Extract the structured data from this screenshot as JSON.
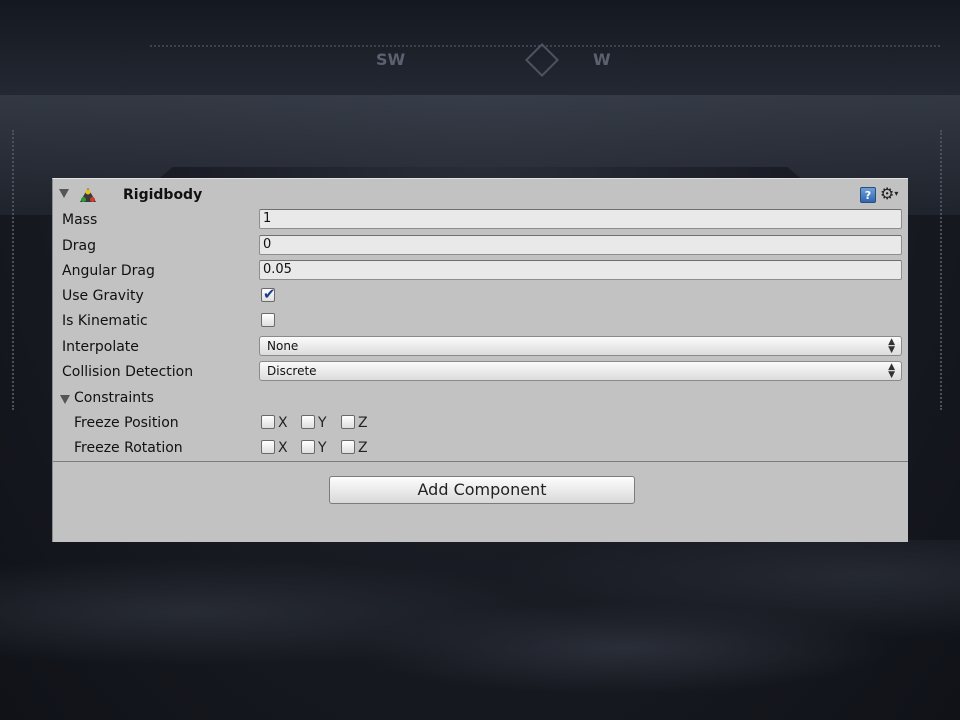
{
  "background": {
    "compass_letters": [
      "SW",
      "W"
    ]
  },
  "inspector": {
    "component": {
      "title": "Rigidbody",
      "help_icon": "help-icon",
      "settings_icon": "gear-icon"
    },
    "fields": {
      "mass": {
        "label": "Mass",
        "value": "1"
      },
      "drag": {
        "label": "Drag",
        "value": "0"
      },
      "angular_drag": {
        "label": "Angular Drag",
        "value": "0.05"
      },
      "use_gravity": {
        "label": "Use Gravity",
        "checked": true
      },
      "is_kinematic": {
        "label": "Is Kinematic",
        "checked": false
      },
      "interpolate": {
        "label": "Interpolate",
        "value": "None"
      },
      "collision_detection": {
        "label": "Collision Detection",
        "value": "Discrete"
      }
    },
    "constraints": {
      "label": "Constraints",
      "freeze_position": {
        "label": "Freeze Position",
        "axes": [
          {
            "name": "X",
            "checked": false
          },
          {
            "name": "Y",
            "checked": false
          },
          {
            "name": "Z",
            "checked": false
          }
        ]
      },
      "freeze_rotation": {
        "label": "Freeze Rotation",
        "axes": [
          {
            "name": "X",
            "checked": false
          },
          {
            "name": "Y",
            "checked": false
          },
          {
            "name": "Z",
            "checked": false
          }
        ]
      }
    },
    "add_component_label": "Add Component"
  },
  "colors": {
    "panel_bg": "#c2c2c2",
    "check_accent": "#1d3e8a",
    "scene_bg": "#1a1d25"
  }
}
